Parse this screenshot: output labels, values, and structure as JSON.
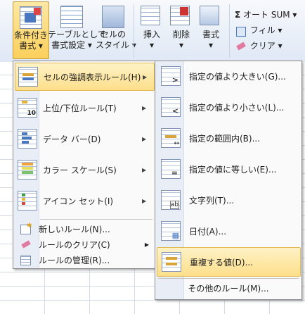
{
  "ribbon": {
    "conditional_formatting": {
      "line1": "条件付き",
      "line2": "書式"
    },
    "format_as_table": {
      "line1": "テーブルとして",
      "line2": "書式設定"
    },
    "cell_styles": {
      "line1": "セルの",
      "line2": "スタイル"
    },
    "insert": "挿入",
    "delete": "削除",
    "format": "書式",
    "autosum": "オート SUM",
    "fill": "フィル",
    "clear": "クリア",
    "sigma_glyph": "Σ"
  },
  "main_menu": {
    "items": [
      {
        "label": "セルの強調表示ルール(H)",
        "icon": "highlight-rules-icon"
      },
      {
        "label": "上位/下位ルール(T)",
        "icon": "top-bottom-icon"
      },
      {
        "label": "データ バー(D)",
        "icon": "data-bars-icon"
      },
      {
        "label": "カラー スケール(S)",
        "icon": "color-scales-icon"
      },
      {
        "label": "アイコン セット(I)",
        "icon": "icon-sets-icon"
      }
    ],
    "small_items": [
      {
        "label": "新しいルール(N)...",
        "icon": "new-rule-icon"
      },
      {
        "label": "ルールのクリア(C)",
        "icon": "clear-rules-icon"
      },
      {
        "label": "ルールの管理(R)...",
        "icon": "manage-rules-icon"
      }
    ],
    "top_bottom_number": "10"
  },
  "sub_menu": {
    "items": [
      {
        "label": "指定の値より大きい(G)...",
        "icon": "greater-than-icon",
        "glyph": ">"
      },
      {
        "label": "指定の値より小さい(L)...",
        "icon": "less-than-icon",
        "glyph": "<"
      },
      {
        "label": "指定の範囲内(B)...",
        "icon": "between-icon",
        "glyph": "↔"
      },
      {
        "label": "指定の値に等しい(E)...",
        "icon": "equal-to-icon",
        "glyph": "="
      },
      {
        "label": "文字列(T)...",
        "icon": "text-contains-icon",
        "glyph": "ab"
      },
      {
        "label": "日付(A)...",
        "icon": "date-icon",
        "glyph": "▦"
      },
      {
        "label": "重複する値(D)...",
        "icon": "duplicate-values-icon",
        "glyph": "≡"
      }
    ],
    "more_rules": "その他のルール(M)..."
  },
  "colors": {
    "highlight": "#fddf8b",
    "accent": "#4a78c0"
  }
}
